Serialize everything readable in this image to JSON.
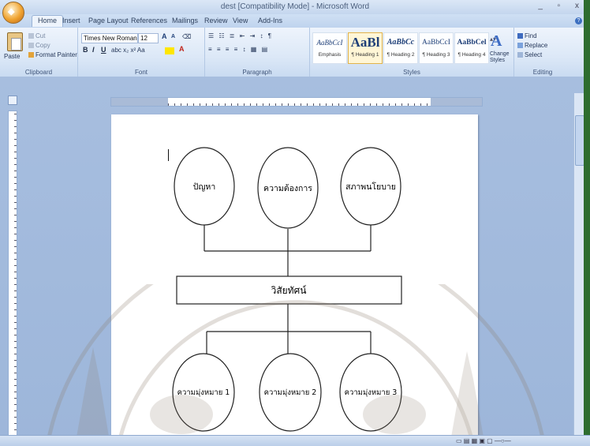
{
  "window": {
    "title": "dest [Compatibility Mode] - Microsoft Word",
    "controls": [
      "_",
      "▫",
      "x"
    ]
  },
  "tabs": [
    "Home",
    "Insert",
    "Page Layout",
    "References",
    "Mailings",
    "Review",
    "View",
    "Add-Ins"
  ],
  "ribbon": {
    "clipboard": {
      "paste": "Paste",
      "cut": "Cut",
      "copy": "Copy",
      "format_painter": "Format Painter",
      "label": "Clipboard"
    },
    "font": {
      "family": "Times New Roman",
      "size": "12",
      "label": "Font",
      "bold": "B",
      "italic": "I",
      "underline": "U",
      "grow": "A",
      "shrink": "A"
    },
    "paragraph": {
      "label": "Paragraph"
    },
    "styles": {
      "label": "Styles",
      "items": [
        {
          "sample": "AaBbCcI",
          "name": "Emphasis"
        },
        {
          "sample": "AaBl",
          "name": "¶ Heading 1"
        },
        {
          "sample": "AaBbCc",
          "name": "¶ Heading 2"
        },
        {
          "sample": "AaBbCcI",
          "name": "¶ Heading 3"
        },
        {
          "sample": "AaBbCel",
          "name": "¶ Heading 4"
        }
      ],
      "change_styles": "Change Styles"
    },
    "editing": {
      "find": "Find",
      "replace": "Replace",
      "select": "Select",
      "label": "Editing"
    }
  },
  "diagram": {
    "top_circles": [
      "ปัญหา",
      "ความต้องการ",
      "สภาพนโยบาย"
    ],
    "middle_box": "วิสัยทัศน์",
    "bottom_circles": [
      "ความมุ่งหมาย 1",
      "ความมุ่งหมาย 2",
      "ความมุ่งหมาย 3"
    ]
  },
  "colors": {
    "ribbon": "#dce8f7",
    "workspace": "#a7bedf",
    "accent": "#3d6cc4"
  }
}
